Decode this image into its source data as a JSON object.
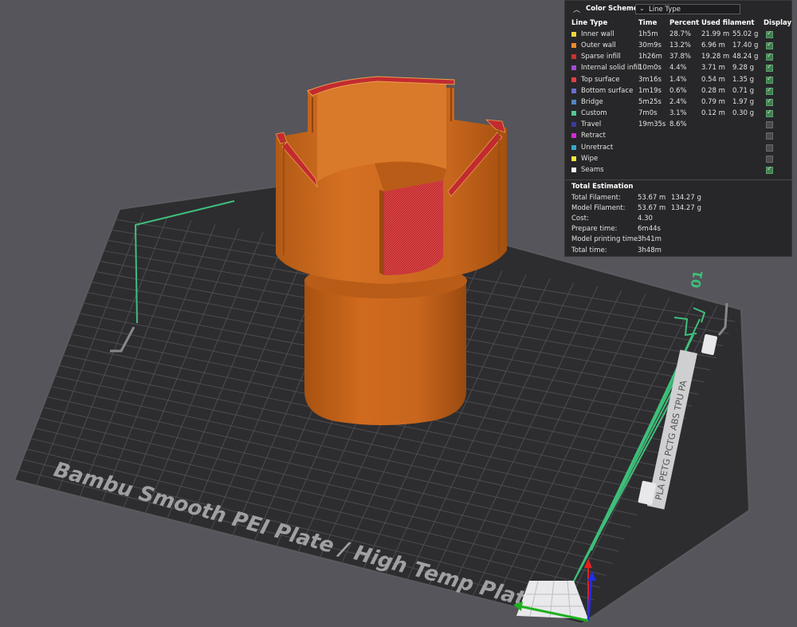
{
  "legend": {
    "title": "Color Scheme",
    "scheme_value": "Line Type",
    "headers": {
      "line_type": "Line Type",
      "time": "Time",
      "percent": "Percent",
      "used": "Used filament",
      "display": "Display"
    },
    "rows": [
      {
        "name": "Inner wall",
        "color": "#f5d33f",
        "time": "1h5m",
        "percent": "28.7%",
        "meters": "21.99 m",
        "grams": "55.02 g",
        "display": true
      },
      {
        "name": "Outer wall",
        "color": "#f08a2a",
        "time": "30m9s",
        "percent": "13.2%",
        "meters": "6.96 m",
        "grams": "17.40 g",
        "display": true
      },
      {
        "name": "Sparse infill",
        "color": "#c8322e",
        "time": "1h26m",
        "percent": "37.8%",
        "meters": "19.28 m",
        "grams": "48.24 g",
        "display": true
      },
      {
        "name": "Internal solid infill",
        "color": "#a24ad6",
        "time": "10m0s",
        "percent": "4.4%",
        "meters": "3.71 m",
        "grams": "9.28 g",
        "display": true
      },
      {
        "name": "Top surface",
        "color": "#e2403f",
        "time": "3m16s",
        "percent": "1.4%",
        "meters": "0.54 m",
        "grams": "1.35 g",
        "display": true
      },
      {
        "name": "Bottom surface",
        "color": "#6a6ed4",
        "time": "1m19s",
        "percent": "0.6%",
        "meters": "0.28 m",
        "grams": "0.71 g",
        "display": true
      },
      {
        "name": "Bridge",
        "color": "#4f86c4",
        "time": "5m25s",
        "percent": "2.4%",
        "meters": "0.79 m",
        "grams": "1.97 g",
        "display": true
      },
      {
        "name": "Custom",
        "color": "#52c994",
        "time": "7m0s",
        "percent": "3.1%",
        "meters": "0.12 m",
        "grams": "0.30 g",
        "display": true
      },
      {
        "name": "Travel",
        "color": "#3a3aa0",
        "time": "19m35s",
        "percent": "8.6%",
        "meters": "",
        "grams": "",
        "display": false
      },
      {
        "name": "Retract",
        "color": "#d52ad8",
        "time": "",
        "percent": "",
        "meters": "",
        "grams": "",
        "display": false
      },
      {
        "name": "Unretract",
        "color": "#37a6c9",
        "time": "",
        "percent": "",
        "meters": "",
        "grams": "",
        "display": false
      },
      {
        "name": "Wipe",
        "color": "#f2e83a",
        "time": "",
        "percent": "",
        "meters": "",
        "grams": "",
        "display": false
      },
      {
        "name": "Seams",
        "color": "#f2f2f2",
        "time": "",
        "percent": "",
        "meters": "",
        "grams": "",
        "display": true
      }
    ],
    "totals_title": "Total Estimation",
    "totals": [
      {
        "label": "Total Filament:",
        "v1": "53.67 m",
        "v2": "134.27 g"
      },
      {
        "label": "Model Filament:",
        "v1": "53.67 m",
        "v2": "134.27 g"
      },
      {
        "label": "Cost:",
        "v1": "4.30",
        "v2": ""
      },
      {
        "label": "Prepare time:",
        "v1": "6m44s",
        "v2": ""
      },
      {
        "label": "Model printing time:",
        "v1": "3h41m",
        "v2": ""
      },
      {
        "label": "Total time:",
        "v1": "3h48m",
        "v2": ""
      }
    ]
  },
  "plate": {
    "name": "Bambu Smooth PEI Plate / High Temp Plate",
    "number": "01",
    "side_label": "PLA PETG PCTG ABS TPU PA",
    "colors": {
      "plate": "#2d2d30",
      "grid": "#4c4c50",
      "edge": "#8a8a8e",
      "text": "#a0a0a4",
      "border_green": "#3fbf7a"
    }
  },
  "model": {
    "colors": {
      "outer": "#c8661e",
      "outer_dark": "#a54f14",
      "outer_light": "#d97a2c",
      "infill": "#c32a30",
      "top": "#e0a050"
    }
  },
  "axes": {
    "x_color": "#1fb01f",
    "y_color": "#1f2fe0",
    "z_color": "#e21f1f"
  }
}
